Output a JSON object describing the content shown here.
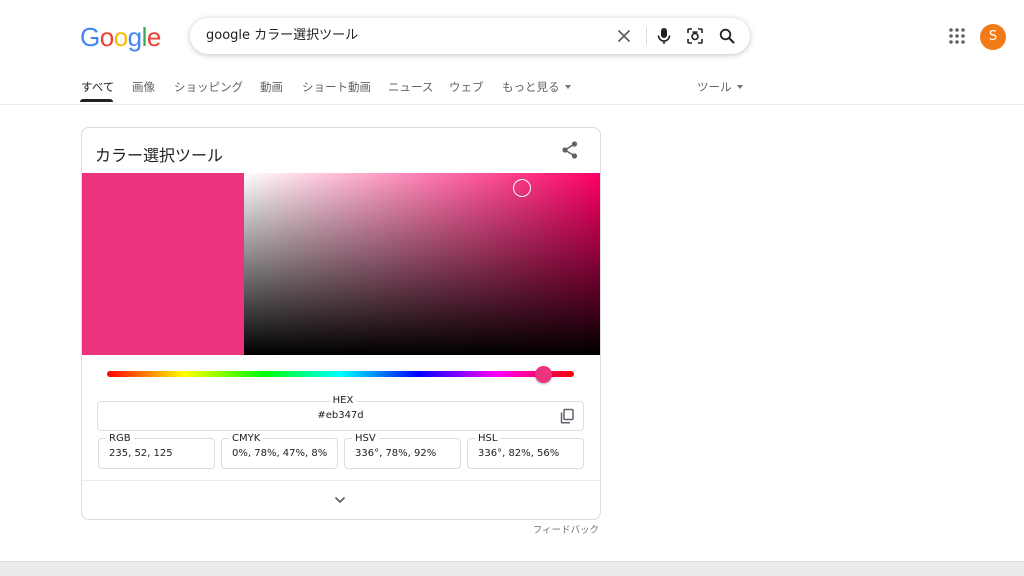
{
  "header": {
    "logo": {
      "letters": [
        "G",
        "o",
        "o",
        "g",
        "l",
        "e"
      ],
      "colors": [
        "#4285f4",
        "#ea4335",
        "#fbbc05",
        "#4285f4",
        "#34a853",
        "#ea4335"
      ]
    },
    "search": {
      "query": "google カラー選択ツール",
      "icons": [
        "close-icon",
        "microphone-icon",
        "lens-camera-icon",
        "search-icon"
      ]
    },
    "apps_icon": "apps-grid-icon",
    "avatar": {
      "initial": "S",
      "color": "#f07b17"
    }
  },
  "nav": {
    "tabs": [
      {
        "label": "すべて",
        "active": true
      },
      {
        "label": "画像",
        "active": false
      },
      {
        "label": "ショッピング",
        "active": false
      },
      {
        "label": "動画",
        "active": false
      },
      {
        "label": "ショート動画",
        "active": false
      },
      {
        "label": "ニュース",
        "active": false
      },
      {
        "label": "ウェブ",
        "active": false
      }
    ],
    "more_label": "もっと見る",
    "tools_label": "ツール"
  },
  "card": {
    "title": "カラー選択ツール",
    "share_icon": "share-icon",
    "selected_color": "#eb347d",
    "fields": {
      "hex": {
        "label": "HEX",
        "value": "#eb347d"
      },
      "rgb": {
        "label": "RGB",
        "value": "235, 52, 125"
      },
      "cmyk": {
        "label": "CMYK",
        "value": "0%, 78%, 47%, 8%"
      },
      "hsv": {
        "label": "HSV",
        "value": "336°, 78%, 92%"
      },
      "hsl": {
        "label": "HSL",
        "value": "336°, 82%, 56%"
      }
    },
    "copy_icon": "copy-icon",
    "expand_icon": "chevron-down-icon"
  },
  "feedback_label": "フィードバック"
}
